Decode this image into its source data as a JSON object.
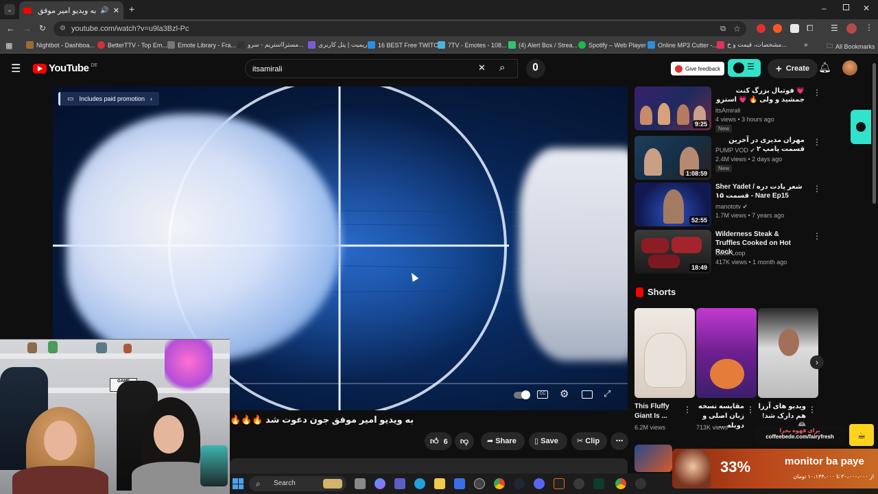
{
  "browser": {
    "tab_title": "به ویدیو امیر موفق جو...",
    "url": "youtube.com/watch?v=u9la3Bzl-Pc",
    "bookmarks": [
      "Nightbot - Dashboa...",
      "BetterTTV - Top Em...",
      "Emote Library - Fra...",
      "مسترااستریم - سرو...",
      "ریمیت | پنل کاربری",
      "16 BEST Free TWITC...",
      "7TV - Emotes - 108...",
      "(4) Alert Box / Strea...",
      "Spotify – Web Player",
      "Online MP3 Cutter -...",
      "مشخصات، قیمت و خ..."
    ],
    "all_bookmarks": "All Bookmarks"
  },
  "youtube": {
    "logo": "YouTube",
    "logo_region": "DE",
    "search_value": "itsamirali",
    "give_feedback": "Give feedback",
    "create": "Create"
  },
  "player": {
    "paid_promotion": "Includes paid promotion"
  },
  "video": {
    "title": "به ویدیو امیر موفق جون دعوت شد 🔥🔥🔥",
    "like_count": "6",
    "share": "Share",
    "save": "Save",
    "clip": "Clip"
  },
  "recommendations": [
    {
      "title": "💗 فوتبال بزرگ کنت جمشید و ولی 🔥 💗 استرو",
      "channel": "itsAmirali",
      "meta": "4 views • 3 hours ago",
      "badge": "New",
      "duration": "9:25",
      "verified": false
    },
    {
      "title": "مهران مدیری در آخرین قسمت پامپ ۲",
      "channel": "PUMP VOD",
      "meta": "2.4M views • 2 days ago",
      "badge": "New",
      "duration": "1:08:59",
      "verified": true
    },
    {
      "title": "Sher Yadet / شعر یادت دره - قسمت ۱۵ Nare Ep15",
      "channel": "manototv",
      "meta": "1.7M views • 7 years ago",
      "badge": "",
      "duration": "52:55",
      "verified": true
    },
    {
      "title": "Wilderness Steak & Truffles Cooked on Hot Rock",
      "channel": "Cook Loop",
      "meta": "417K views • 1 month ago",
      "badge": "",
      "duration": "18:49",
      "verified": false
    }
  ],
  "shorts": {
    "heading": "Shorts",
    "items": [
      {
        "title": "This Fluffy Giant Is ...",
        "views": "6.2M views"
      },
      {
        "title": "مقایسه نسخه زبان اصلی و دوبله ...",
        "views": "713K views"
      },
      {
        "title": "ویدیو های آرزا هم دارک شد!😂 ...",
        "views": ""
      }
    ]
  },
  "taskbar": {
    "search": "Search"
  },
  "overlays": {
    "donation_line1": "برای قهوه بخرا",
    "donation_line2": "coffeebede.com/fairyfresh",
    "promo_percent": "33%",
    "promo_title": "monitor ba paye",
    "promo_price": "از ۳۰،۰۰۰،۰۰۰ تا ۱۰،۱۴۴،۰۰۰ تومان"
  },
  "colors": {
    "youtube_red": "#ff0000",
    "background": "#0f0f0f",
    "accent_teal": "#30e3ca"
  }
}
